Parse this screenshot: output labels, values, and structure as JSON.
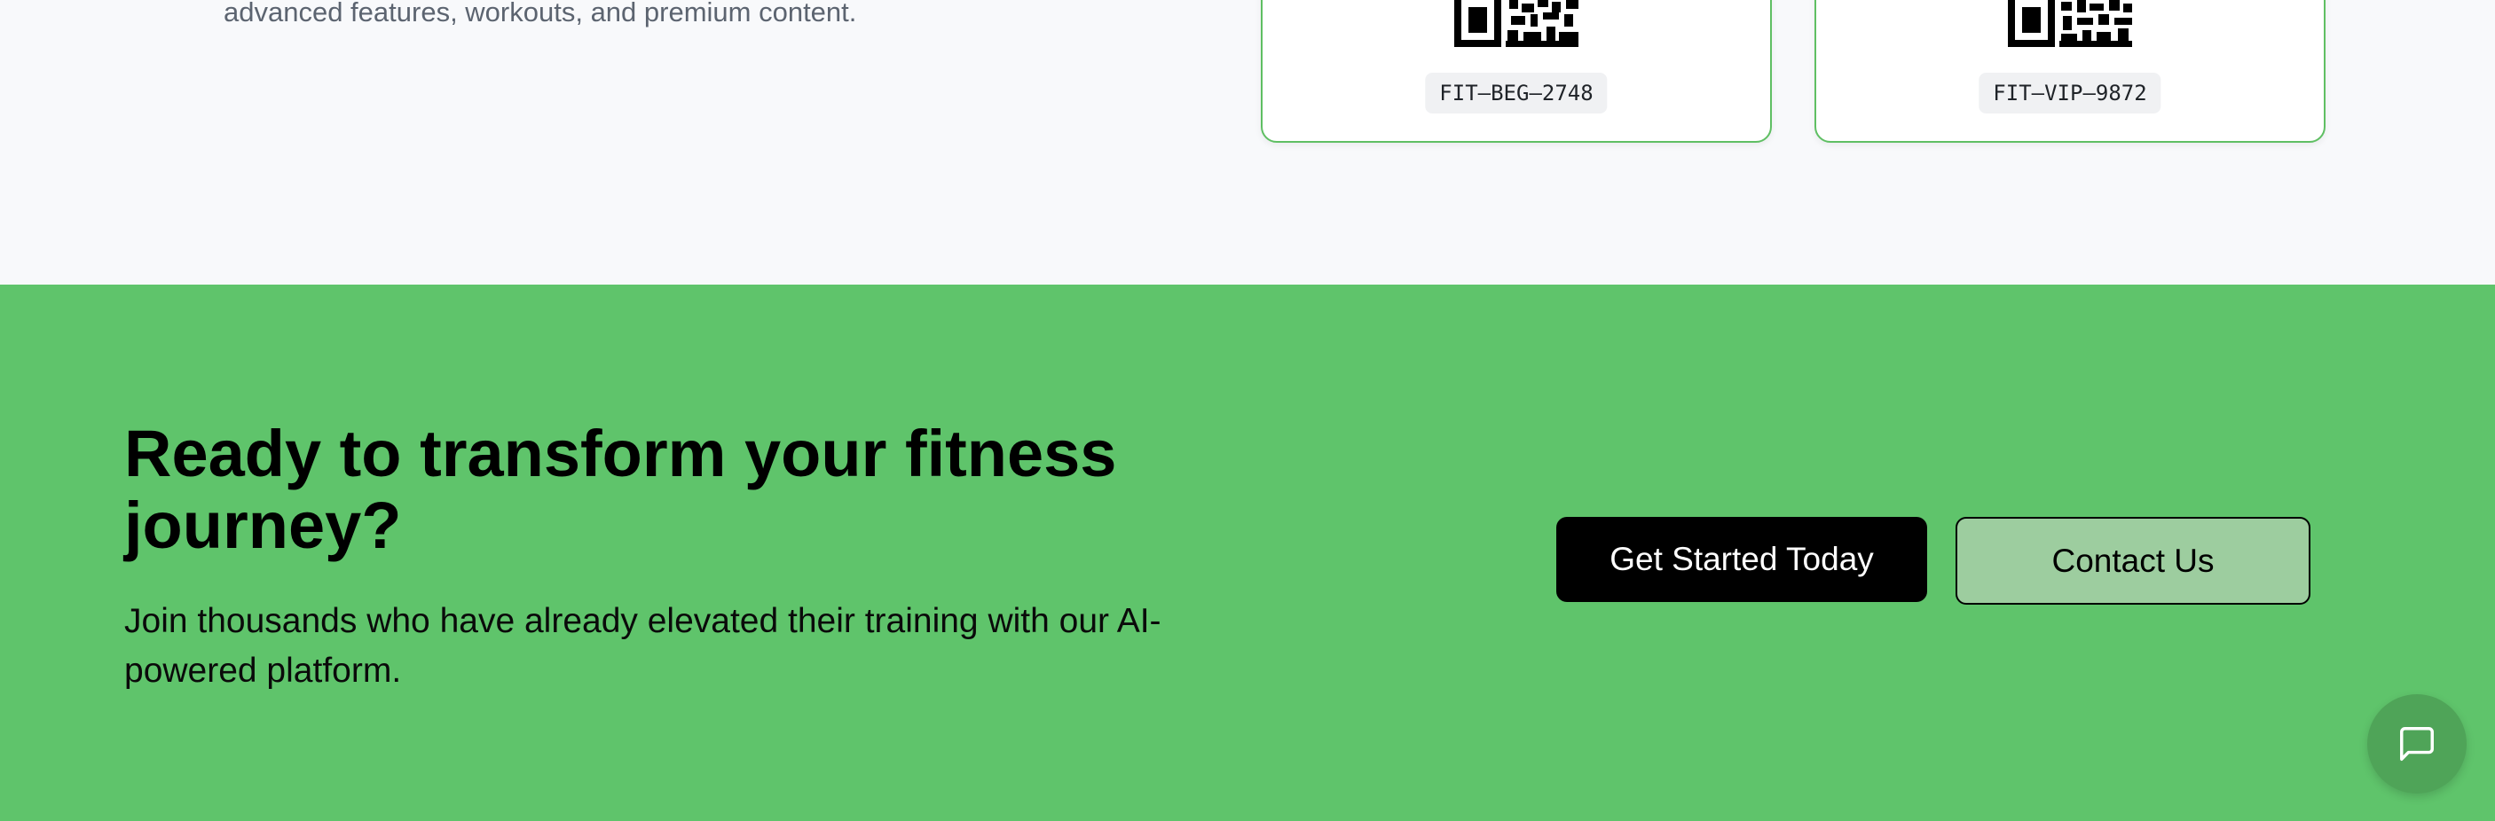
{
  "top": {
    "description": "advanced features, workouts, and premium content.",
    "codes": [
      {
        "code": "FIT–BEG–2748"
      },
      {
        "code": "FIT–VIP–9872"
      }
    ]
  },
  "cta": {
    "title": "Ready to transform your fitness journey?",
    "subtitle": "Join thousands who have already elevated their training with our AI-powered platform.",
    "primary_button": "Get Started Today",
    "secondary_button": "Contact Us"
  },
  "chat": {
    "icon": "chat-bubble-icon"
  },
  "colors": {
    "cta_background": "#5fc46b",
    "card_border": "#5fbf63",
    "primary_button": "#000000",
    "secondary_button": "#9dcd9f",
    "chat_fab": "#4fa458"
  }
}
